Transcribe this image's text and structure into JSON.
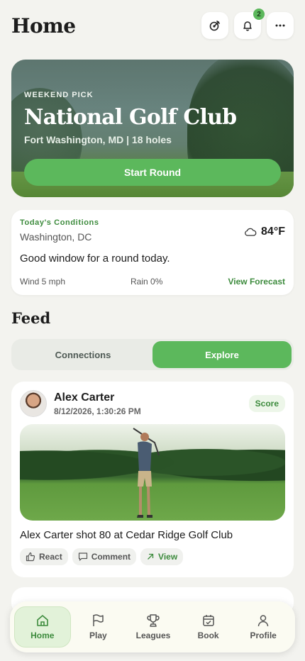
{
  "header": {
    "title": "Home",
    "notification_count": "2"
  },
  "hero": {
    "eyebrow": "WEEKEND PICK",
    "title": "National Golf Club",
    "subtitle": "Fort Washington, MD | 18 holes",
    "button": "Start Round"
  },
  "conditions": {
    "label": "Today's Conditions",
    "location": "Washington, DC",
    "temperature": "84°F",
    "message": "Good window for a round today.",
    "wind": "Wind 5 mph",
    "rain": "Rain 0%",
    "forecast_link": "View Forecast"
  },
  "feed": {
    "title": "Feed",
    "tabs": [
      {
        "label": "Connections"
      },
      {
        "label": "Explore"
      }
    ],
    "active_tab": "Explore",
    "post": {
      "author": "Alex Carter",
      "date": "8/12/2026, 1:30:26 PM",
      "tag": "Score",
      "text": "Alex Carter shot 80 at Cedar Ridge Golf Club",
      "actions": [
        {
          "label": "React"
        },
        {
          "label": "Comment"
        },
        {
          "label": "View"
        }
      ]
    }
  },
  "tabbar": {
    "items": [
      {
        "label": "Home"
      },
      {
        "label": "Play"
      },
      {
        "label": "Leagues"
      },
      {
        "label": "Book"
      },
      {
        "label": "Profile"
      }
    ],
    "active": "Home"
  },
  "colors": {
    "accent": "#5cb85c",
    "accent_text": "#3d8b3d",
    "background": "#f3f3ef"
  }
}
